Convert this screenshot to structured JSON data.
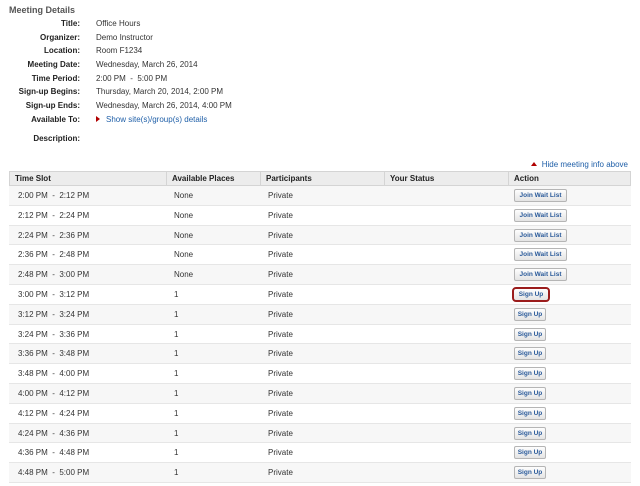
{
  "meeting": {
    "section_title": "Meeting Details",
    "fields": [
      {
        "label": "Title:",
        "value": "Office Hours"
      },
      {
        "label": "Organizer:",
        "value": "Demo Instructor"
      },
      {
        "label": "Location:",
        "value": "Room F1234"
      },
      {
        "label": "Meeting Date:",
        "value": "Wednesday, March 26, 2014"
      },
      {
        "label": "Time Period:",
        "value": "2:00 PM  -  5:00 PM"
      },
      {
        "label": "Sign-up Begins:",
        "value": "Thursday, March 20, 2014, 2:00 PM"
      },
      {
        "label": "Sign-up Ends:",
        "value": "Wednesday, March 26, 2014, 4:00 PM"
      },
      {
        "label": "Available To:",
        "value": "Show site(s)/group(s) details"
      },
      {
        "label": "Description:",
        "value": ""
      }
    ],
    "hide_link": "Hide meeting info above"
  },
  "table": {
    "headers": [
      "Time Slot",
      "Available Places",
      "Participants",
      "Your Status",
      "Action"
    ],
    "rows": [
      {
        "time": "2:00 PM  -  2:12 PM",
        "places": "None",
        "participants": "Private",
        "status": "",
        "action": "Join Wait List"
      },
      {
        "time": "2:12 PM  -  2:24 PM",
        "places": "None",
        "participants": "Private",
        "status": "",
        "action": "Join Wait List"
      },
      {
        "time": "2:24 PM  -  2:36 PM",
        "places": "None",
        "participants": "Private",
        "status": "",
        "action": "Join Wait List"
      },
      {
        "time": "2:36 PM  -  2:48 PM",
        "places": "None",
        "participants": "Private",
        "status": "",
        "action": "Join Wait List"
      },
      {
        "time": "2:48 PM  -  3:00 PM",
        "places": "None",
        "participants": "Private",
        "status": "",
        "action": "Join Wait List"
      },
      {
        "time": "3:00 PM  -  3:12 PM",
        "places": "1",
        "participants": "Private",
        "status": "",
        "action": "Sign Up"
      },
      {
        "time": "3:12 PM  -  3:24 PM",
        "places": "1",
        "participants": "Private",
        "status": "",
        "action": "Sign Up"
      },
      {
        "time": "3:24 PM  -  3:36 PM",
        "places": "1",
        "participants": "Private",
        "status": "",
        "action": "Sign Up"
      },
      {
        "time": "3:36 PM  -  3:48 PM",
        "places": "1",
        "participants": "Private",
        "status": "",
        "action": "Sign Up"
      },
      {
        "time": "3:48 PM  -  4:00 PM",
        "places": "1",
        "participants": "Private",
        "status": "",
        "action": "Sign Up"
      },
      {
        "time": "4:00 PM  -  4:12 PM",
        "places": "1",
        "participants": "Private",
        "status": "",
        "action": "Sign Up"
      },
      {
        "time": "4:12 PM  -  4:24 PM",
        "places": "1",
        "participants": "Private",
        "status": "",
        "action": "Sign Up"
      },
      {
        "time": "4:24 PM  -  4:36 PM",
        "places": "1",
        "participants": "Private",
        "status": "",
        "action": "Sign Up"
      },
      {
        "time": "4:36 PM  -  4:48 PM",
        "places": "1",
        "participants": "Private",
        "status": "",
        "action": "Sign Up"
      },
      {
        "time": "4:48 PM  -  5:00 PM",
        "places": "1",
        "participants": "Private",
        "status": "",
        "action": "Sign Up"
      }
    ]
  },
  "colors": {
    "link": "#1f5fa8",
    "header_bg": "#ececec",
    "highlight": "#9b1c1c",
    "arrow": "#b00000"
  }
}
